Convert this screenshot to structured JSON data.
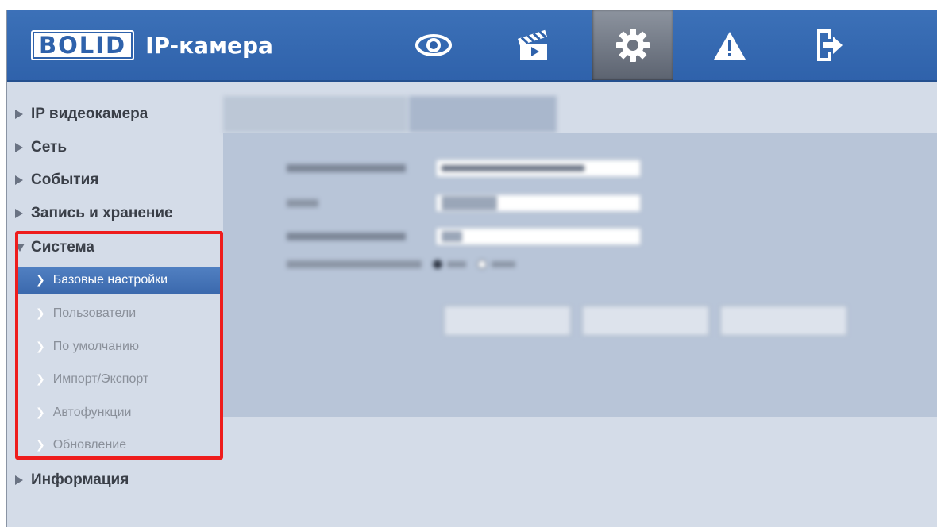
{
  "app": {
    "logo_text": "BOLID",
    "title": "IP-камера"
  },
  "topnav": [
    {
      "name": "live-view",
      "icon": "eye-icon"
    },
    {
      "name": "playback",
      "icon": "clapperboard-icon"
    },
    {
      "name": "settings",
      "icon": "gear-icon",
      "active": true
    },
    {
      "name": "alarm",
      "icon": "warning-icon"
    },
    {
      "name": "logout",
      "icon": "exit-icon"
    }
  ],
  "sidebar": {
    "items": [
      {
        "label": "IP видеокамера",
        "expanded": false
      },
      {
        "label": "Сеть",
        "expanded": false
      },
      {
        "label": "События",
        "expanded": false
      },
      {
        "label": "Запись и хранение",
        "expanded": false
      },
      {
        "label": "Система",
        "expanded": true
      },
      {
        "label": "Информация",
        "expanded": false
      }
    ],
    "system_subitems": [
      {
        "label": "Базовые настройки",
        "active": true
      },
      {
        "label": "Пользователи",
        "active": false
      },
      {
        "label": "По умолчанию",
        "active": false
      },
      {
        "label": "Импорт/Экспорт",
        "active": false
      },
      {
        "label": "Автофункции",
        "active": false
      },
      {
        "label": "Обновление",
        "active": false
      }
    ]
  },
  "colors": {
    "header": "#3c71b8",
    "active_item": "#4a79bd",
    "highlight": "#ee1c1c",
    "background": "#d4dce8"
  }
}
